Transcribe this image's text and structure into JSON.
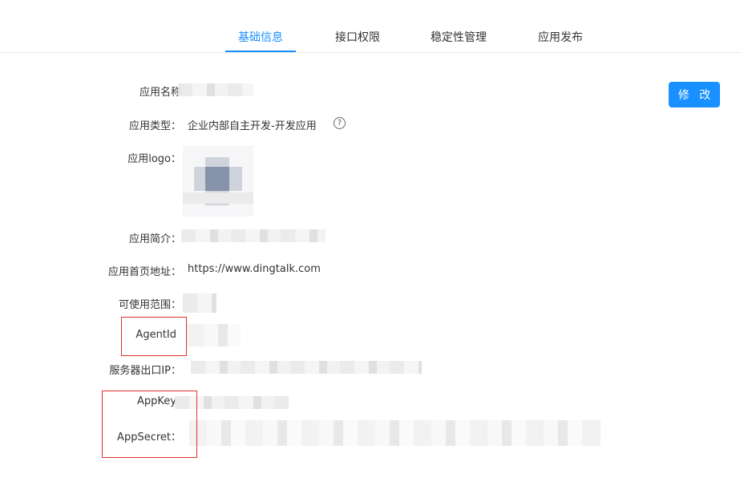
{
  "tabs": [
    {
      "label": "基础信息"
    },
    {
      "label": "接口权限"
    },
    {
      "label": "稳定性管理"
    },
    {
      "label": "应用发布"
    }
  ],
  "edit_button": "修 改",
  "fields": {
    "app_name": {
      "label": "应用名称"
    },
    "app_type": {
      "label": "应用类型：",
      "value": "企业内部自主开发-开发应用"
    },
    "app_logo": {
      "label": "应用logo："
    },
    "app_intro": {
      "label": "应用简介："
    },
    "homepage": {
      "label": "应用首页地址：",
      "value": "https://www.dingtalk.com"
    },
    "scope": {
      "label": "可使用范围："
    },
    "agent_id": {
      "label": "AgentId"
    },
    "egress_ip": {
      "label": "服务器出口IP："
    },
    "app_key": {
      "label": "AppKey"
    },
    "app_secret": {
      "label": "AppSecret："
    }
  },
  "icons": {
    "help": "help-circle-icon",
    "logo": "app-logo-image"
  },
  "colors": {
    "accent": "#1890ff",
    "highlight_box": "#e0302c"
  }
}
